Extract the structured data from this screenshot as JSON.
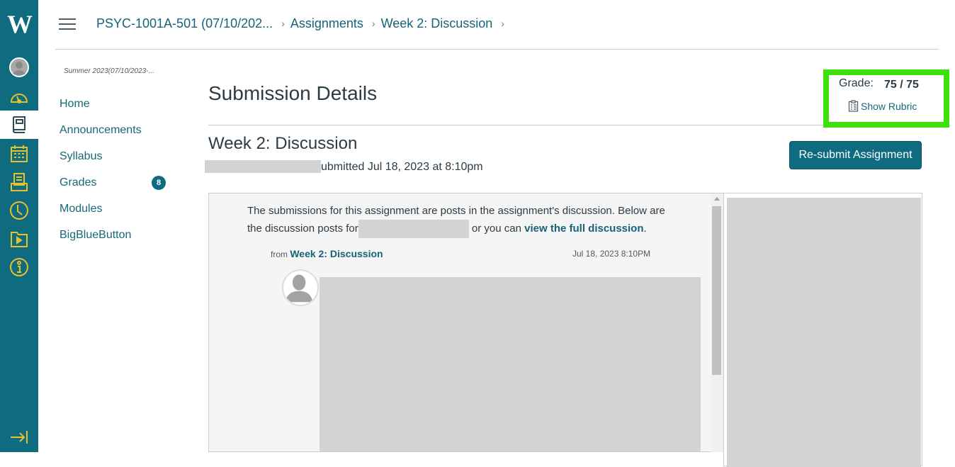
{
  "global_nav": {
    "logo": "W",
    "colors": {
      "background": "#0f6b80",
      "icon": "#e5c12a",
      "active_bg": "#ffffff"
    },
    "items": [
      {
        "name": "account",
        "icon": "avatar-icon"
      },
      {
        "name": "dashboard",
        "icon": "dashboard-icon"
      },
      {
        "name": "courses",
        "icon": "book-icon",
        "active": true
      },
      {
        "name": "calendar",
        "icon": "calendar-icon"
      },
      {
        "name": "inbox",
        "icon": "inbox-icon"
      },
      {
        "name": "history",
        "icon": "clock-icon"
      },
      {
        "name": "studio",
        "icon": "folder-play-icon"
      },
      {
        "name": "help",
        "icon": "info-icon"
      }
    ],
    "collapse_icon": "collapse-arrow-icon"
  },
  "header": {
    "breadcrumb": [
      {
        "label": "PSYC-1001A-501 (07/10/202..."
      },
      {
        "label": "Assignments"
      },
      {
        "label": "Week 2: Discussion"
      }
    ]
  },
  "course_nav": {
    "term": "Summer 2023(07/10/2023-...",
    "items": [
      {
        "label": "Home"
      },
      {
        "label": "Announcements"
      },
      {
        "label": "Syllabus"
      },
      {
        "label": "Grades",
        "badge": "8"
      },
      {
        "label": "Modules"
      },
      {
        "label": "BigBlueButton"
      }
    ]
  },
  "main": {
    "page_title": "Submission Details",
    "grade": {
      "label": "Grade:",
      "value": "75 / 75",
      "rubric_link": "Show Rubric",
      "highlight_color": "#3ee00c"
    },
    "assignment_title": "Week 2: Discussion",
    "submitted_text": "ubmitted Jul 18, 2023 at 8:10pm",
    "resubmit_button": "Re-submit Assignment",
    "submission": {
      "intro_part1": "The submissions for this assignment are posts in the assignment's discussion. Below are the discussion posts for",
      "intro_part2": " or you can ",
      "full_discussion_link": "view the full discussion",
      "intro_end": ".",
      "from_label": "from ",
      "from_link": "Week 2: Discussion",
      "post_date": "Jul 18, 2023 8:10PM"
    }
  }
}
